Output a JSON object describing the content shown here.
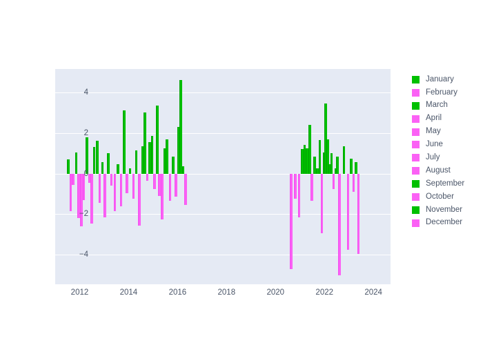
{
  "chart_data": {
    "type": "bar",
    "title": "",
    "subtitle": "",
    "xlabel": "",
    "ylabel": "",
    "xlim": [
      2011.0,
      2024.7
    ],
    "ylim": [
      -5.45,
      5.15
    ],
    "xticks": [
      2012,
      2014,
      2016,
      2018,
      2020,
      2022,
      2024
    ],
    "yticks": [
      -4,
      -2,
      0,
      2,
      4
    ],
    "grid": true,
    "legend_position": "right",
    "colors": {
      "positive": "#00c000",
      "negative": "#fb61f5",
      "plot_background": "#e5eaf4",
      "page_background": "#ffffff",
      "gridline": "#ffffff",
      "tick_label": "#4a5568"
    },
    "legend": [
      {
        "label": "January",
        "color": "#00c000"
      },
      {
        "label": "February",
        "color": "#fb61f5"
      },
      {
        "label": "March",
        "color": "#00c000"
      },
      {
        "label": "April",
        "color": "#fb61f5"
      },
      {
        "label": "May",
        "color": "#fb61f5"
      },
      {
        "label": "June",
        "color": "#fb61f5"
      },
      {
        "label": "July",
        "color": "#fb61f5"
      },
      {
        "label": "August",
        "color": "#fb61f5"
      },
      {
        "label": "September",
        "color": "#00c000"
      },
      {
        "label": "October",
        "color": "#fb61f5"
      },
      {
        "label": "November",
        "color": "#00c000"
      },
      {
        "label": "December",
        "color": "#fb61f5"
      }
    ],
    "points": [
      {
        "x": 2011.52,
        "y": 0.7
      },
      {
        "x": 2011.62,
        "y": -1.85
      },
      {
        "x": 2011.72,
        "y": -0.55
      },
      {
        "x": 2011.85,
        "y": 1.05
      },
      {
        "x": 2011.95,
        "y": -2.2
      },
      {
        "x": 2012.05,
        "y": -2.6
      },
      {
        "x": 2012.15,
        "y": -1.3
      },
      {
        "x": 2012.28,
        "y": 1.8
      },
      {
        "x": 2012.38,
        "y": -0.45
      },
      {
        "x": 2012.48,
        "y": -2.45
      },
      {
        "x": 2012.58,
        "y": 1.3
      },
      {
        "x": 2012.7,
        "y": 1.6
      },
      {
        "x": 2012.8,
        "y": -1.45
      },
      {
        "x": 2012.92,
        "y": 0.55
      },
      {
        "x": 2013.02,
        "y": -2.15
      },
      {
        "x": 2013.15,
        "y": 1.0
      },
      {
        "x": 2013.28,
        "y": -0.6
      },
      {
        "x": 2013.42,
        "y": -1.85
      },
      {
        "x": 2013.55,
        "y": 0.45
      },
      {
        "x": 2013.68,
        "y": -1.6
      },
      {
        "x": 2013.8,
        "y": 3.1
      },
      {
        "x": 2013.92,
        "y": -0.95
      },
      {
        "x": 2014.05,
        "y": 0.25
      },
      {
        "x": 2014.18,
        "y": -1.25
      },
      {
        "x": 2014.3,
        "y": 1.15
      },
      {
        "x": 2014.42,
        "y": -2.55
      },
      {
        "x": 2014.55,
        "y": 1.35
      },
      {
        "x": 2014.65,
        "y": 3.0
      },
      {
        "x": 2014.75,
        "y": -0.35
      },
      {
        "x": 2014.85,
        "y": 1.55
      },
      {
        "x": 2014.95,
        "y": 1.85
      },
      {
        "x": 2015.05,
        "y": -0.75
      },
      {
        "x": 2015.15,
        "y": 3.35
      },
      {
        "x": 2015.25,
        "y": -1.1
      },
      {
        "x": 2015.35,
        "y": -2.25
      },
      {
        "x": 2015.45,
        "y": 1.25
      },
      {
        "x": 2015.55,
        "y": 1.7
      },
      {
        "x": 2015.68,
        "y": -1.35
      },
      {
        "x": 2015.8,
        "y": 0.85
      },
      {
        "x": 2015.92,
        "y": -1.15
      },
      {
        "x": 2016.02,
        "y": 2.3
      },
      {
        "x": 2016.12,
        "y": 4.6
      },
      {
        "x": 2016.22,
        "y": 0.35
      },
      {
        "x": 2016.32,
        "y": -1.55
      },
      {
        "x": 2020.62,
        "y": -4.7
      },
      {
        "x": 2020.8,
        "y": -1.25
      },
      {
        "x": 2020.95,
        "y": -2.15
      },
      {
        "x": 2021.08,
        "y": 1.2
      },
      {
        "x": 2021.18,
        "y": 1.4
      },
      {
        "x": 2021.28,
        "y": 1.25
      },
      {
        "x": 2021.38,
        "y": 2.4
      },
      {
        "x": 2021.48,
        "y": -1.35
      },
      {
        "x": 2021.58,
        "y": 0.85
      },
      {
        "x": 2021.7,
        "y": 0.25
      },
      {
        "x": 2021.8,
        "y": 1.65
      },
      {
        "x": 2021.88,
        "y": -2.95
      },
      {
        "x": 2021.96,
        "y": 1.05
      },
      {
        "x": 2022.04,
        "y": 3.45
      },
      {
        "x": 2022.12,
        "y": 1.7
      },
      {
        "x": 2022.2,
        "y": 0.45
      },
      {
        "x": 2022.28,
        "y": 1.0
      },
      {
        "x": 2022.36,
        "y": -0.75
      },
      {
        "x": 2022.44,
        "y": 0.25
      },
      {
        "x": 2022.52,
        "y": 0.85
      },
      {
        "x": 2022.6,
        "y": -5.0
      },
      {
        "x": 2022.78,
        "y": 1.35
      },
      {
        "x": 2022.95,
        "y": -3.75
      },
      {
        "x": 2023.08,
        "y": 0.75
      },
      {
        "x": 2023.18,
        "y": -0.9
      },
      {
        "x": 2023.28,
        "y": 0.55
      },
      {
        "x": 2023.38,
        "y": -3.95
      }
    ]
  }
}
